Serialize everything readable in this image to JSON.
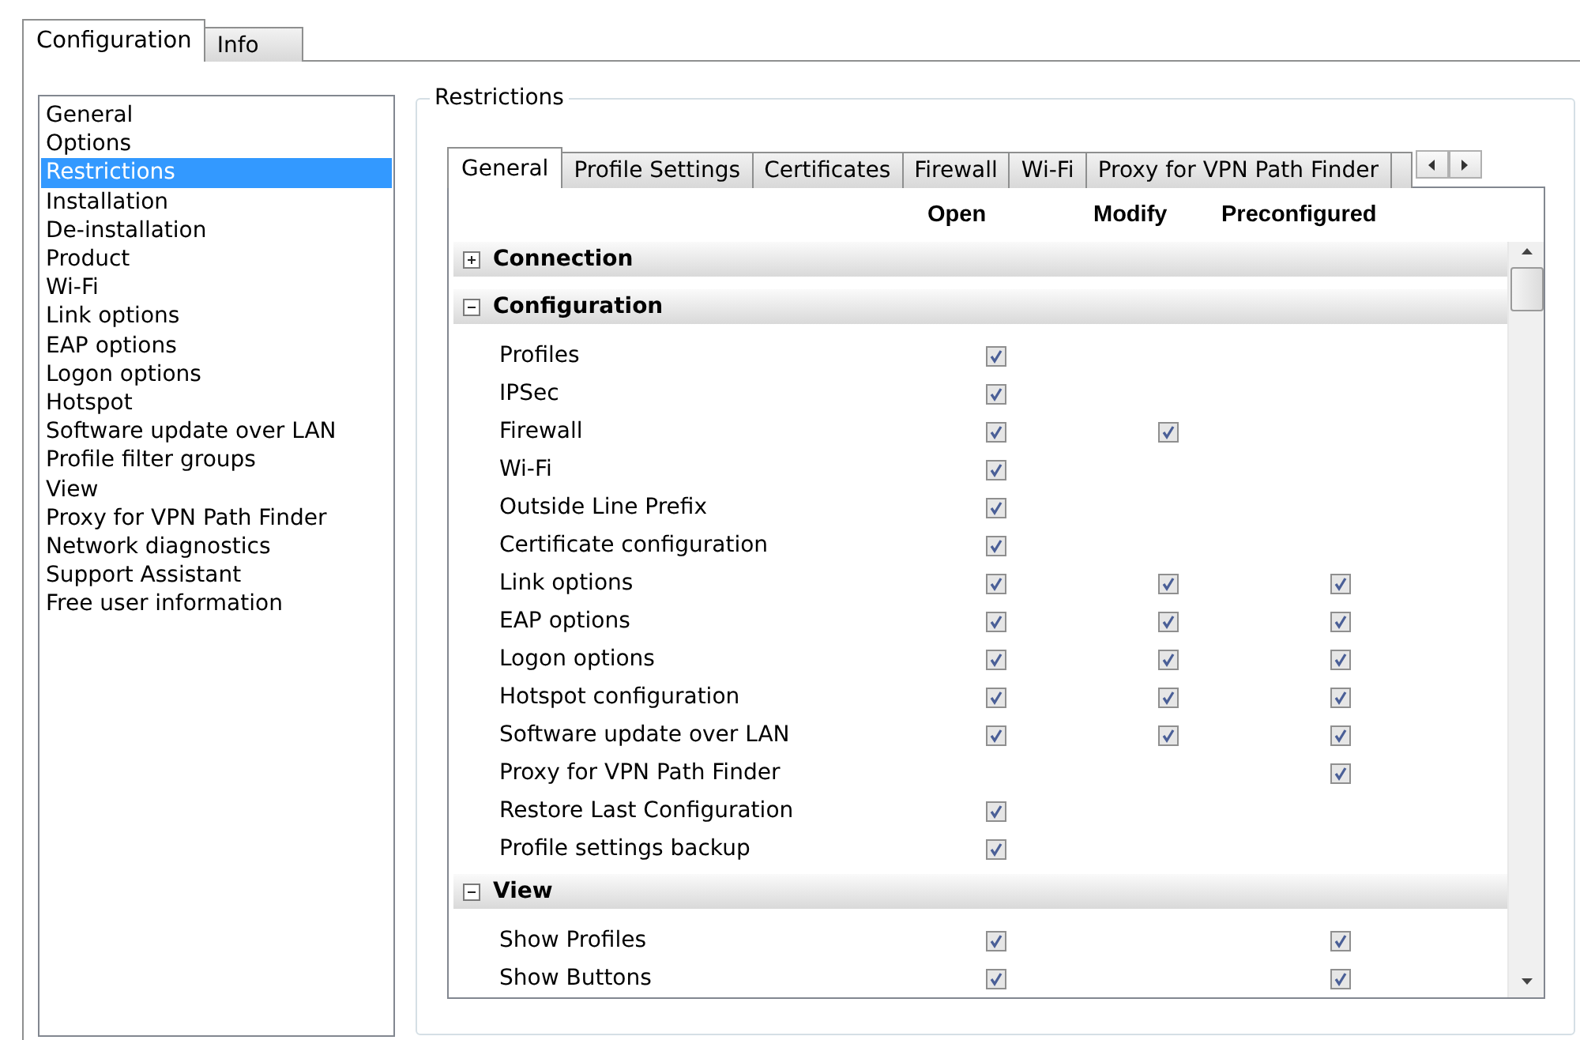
{
  "tabs": [
    {
      "label": "Configuration",
      "selected": true
    },
    {
      "label": "Info",
      "selected": false
    }
  ],
  "sidebar": {
    "items": [
      {
        "label": "General",
        "selected": false
      },
      {
        "label": "Options",
        "selected": false
      },
      {
        "label": "Restrictions",
        "selected": true
      },
      {
        "label": "Installation",
        "selected": false
      },
      {
        "label": "De-installation",
        "selected": false
      },
      {
        "label": "Product",
        "selected": false
      },
      {
        "label": "Wi-Fi",
        "selected": false
      },
      {
        "label": "Link options",
        "selected": false
      },
      {
        "label": "EAP options",
        "selected": false
      },
      {
        "label": "Logon options",
        "selected": false
      },
      {
        "label": "Hotspot",
        "selected": false
      },
      {
        "label": "Software update over LAN",
        "selected": false
      },
      {
        "label": "Profile filter groups",
        "selected": false
      },
      {
        "label": "View",
        "selected": false
      },
      {
        "label": "Proxy for VPN Path Finder",
        "selected": false
      },
      {
        "label": "Network diagnostics",
        "selected": false
      },
      {
        "label": "Support Assistant",
        "selected": false
      },
      {
        "label": "Free user information",
        "selected": false
      }
    ]
  },
  "restrictions": {
    "title": "Restrictions",
    "tabs": [
      {
        "label": "General",
        "selected": true
      },
      {
        "label": "Profile Settings",
        "selected": false
      },
      {
        "label": "Certificates",
        "selected": false
      },
      {
        "label": "Firewall",
        "selected": false
      },
      {
        "label": "Wi-Fi",
        "selected": false
      },
      {
        "label": "Proxy for VPN Path Finder",
        "selected": false
      }
    ],
    "columns": [
      "Open",
      "Modify",
      "Preconfigured"
    ],
    "groups": [
      {
        "label": "Connection",
        "expanded": false
      },
      {
        "label": "Configuration",
        "expanded": true,
        "rows": [
          {
            "label": "Profiles",
            "open": true
          },
          {
            "label": "IPSec",
            "open": true
          },
          {
            "label": "Firewall",
            "open": true,
            "modify": true
          },
          {
            "label": "Wi-Fi",
            "open": true
          },
          {
            "label": "Outside Line Prefix",
            "open": true
          },
          {
            "label": "Certificate configuration",
            "open": true
          },
          {
            "label": "Link options",
            "open": true,
            "modify": true,
            "preconfigured": true
          },
          {
            "label": "EAP options",
            "open": true,
            "modify": true,
            "preconfigured": true
          },
          {
            "label": "Logon options",
            "open": true,
            "modify": true,
            "preconfigured": true
          },
          {
            "label": "Hotspot configuration",
            "open": true,
            "modify": true,
            "preconfigured": true
          },
          {
            "label": "Software update over LAN",
            "open": true,
            "modify": true,
            "preconfigured": true
          },
          {
            "label": "Proxy for VPN Path Finder",
            "preconfigured": true
          },
          {
            "label": "Restore Last Configuration",
            "open": true
          },
          {
            "label": "Profile settings backup",
            "open": true
          }
        ]
      },
      {
        "label": "View",
        "expanded": true,
        "rows": [
          {
            "label": "Show Profiles",
            "open": true,
            "preconfigured": true
          },
          {
            "label": "Show Buttons",
            "open": true,
            "preconfigured": true
          }
        ]
      }
    ]
  }
}
